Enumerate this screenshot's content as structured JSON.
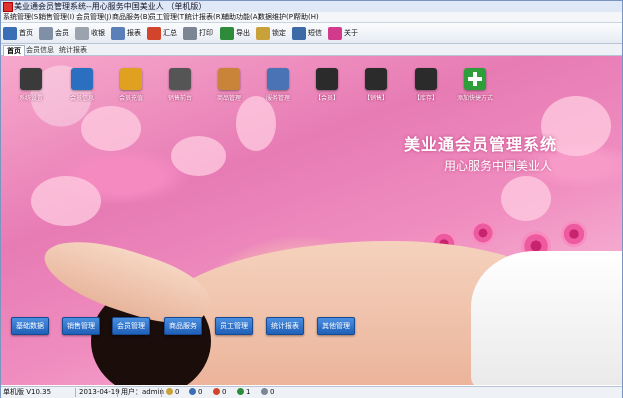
{
  "window": {
    "title": "美业通会员管理系统--用心服务中国美业人 （单机版）"
  },
  "menu": [
    "系统管理(S)",
    "销售管理(I)",
    "会员管理(J)",
    "商品服务(B)",
    "员工管理(T)",
    "统计报表(R)",
    "辅助功能(A)",
    "数据维护(P)",
    "帮助(H)"
  ],
  "toolbar": [
    {
      "label": "首页",
      "icon": "monitor-icon",
      "color": "#3a6fb5"
    },
    {
      "label": "会员",
      "icon": "member-card-icon",
      "color": "#7e8fa6"
    },
    {
      "label": "收银",
      "icon": "cashier-grid-icon",
      "color": "#9aa3ae"
    },
    {
      "label": "报表",
      "icon": "report-grid-icon",
      "color": "#5b7fb8"
    },
    {
      "label": "汇总",
      "icon": "bar-chart-icon",
      "color": "#d2452c"
    },
    {
      "label": "打印",
      "icon": "printer-icon",
      "color": "#7b8594"
    },
    {
      "label": "导出",
      "icon": "excel-export-icon",
      "color": "#2e8b3a"
    },
    {
      "label": "锁定",
      "icon": "lock-icon",
      "color": "#c9a13a"
    },
    {
      "label": "短信",
      "icon": "sms-monitor-icon",
      "color": "#3b6aa6"
    },
    {
      "label": "关于",
      "icon": "about-icon",
      "color": "#d23a8c"
    }
  ],
  "tabs": [
    "首页",
    "会员信息",
    "统计报表"
  ],
  "quick_tiles": [
    {
      "label": "系统设置",
      "icon": "settings-icon",
      "color": "#3a3a3a"
    },
    {
      "label": "会员信息",
      "icon": "member-icon",
      "color": "#2a6fc0"
    },
    {
      "label": "会员充值",
      "icon": "recharge-icon",
      "color": "#e0a020"
    },
    {
      "label": "销售前台",
      "icon": "calculator-icon",
      "color": "#555555"
    },
    {
      "label": "商品管理",
      "icon": "goods-box-icon",
      "color": "#c9843a"
    },
    {
      "label": "服务管理",
      "icon": "service-icon",
      "color": "#4a73b5"
    },
    {
      "label": "【会员】",
      "icon": "member-report-icon",
      "color": "#2b2b2b"
    },
    {
      "label": "【销售】",
      "icon": "sales-report-icon",
      "color": "#2b2b2b"
    },
    {
      "label": "【库存】",
      "icon": "stock-report-icon",
      "color": "#2b2b2b"
    },
    {
      "label": "添加快捷方式",
      "icon": "add-shortcut-icon",
      "color": "#2e9e3a"
    }
  ],
  "banner": {
    "title": "美业通会员管理系统",
    "subtitle": "用心服务中国美业人"
  },
  "bottom_buttons": [
    "基础数据",
    "销售管理",
    "会员管理",
    "商品服务",
    "员工管理",
    "统计报表",
    "其他管理"
  ],
  "status": {
    "version": "单机版 V10.35",
    "date": "2013-04-19",
    "user": "用户：admin",
    "counts": [
      "0",
      "0",
      "0",
      "1",
      "0"
    ]
  }
}
